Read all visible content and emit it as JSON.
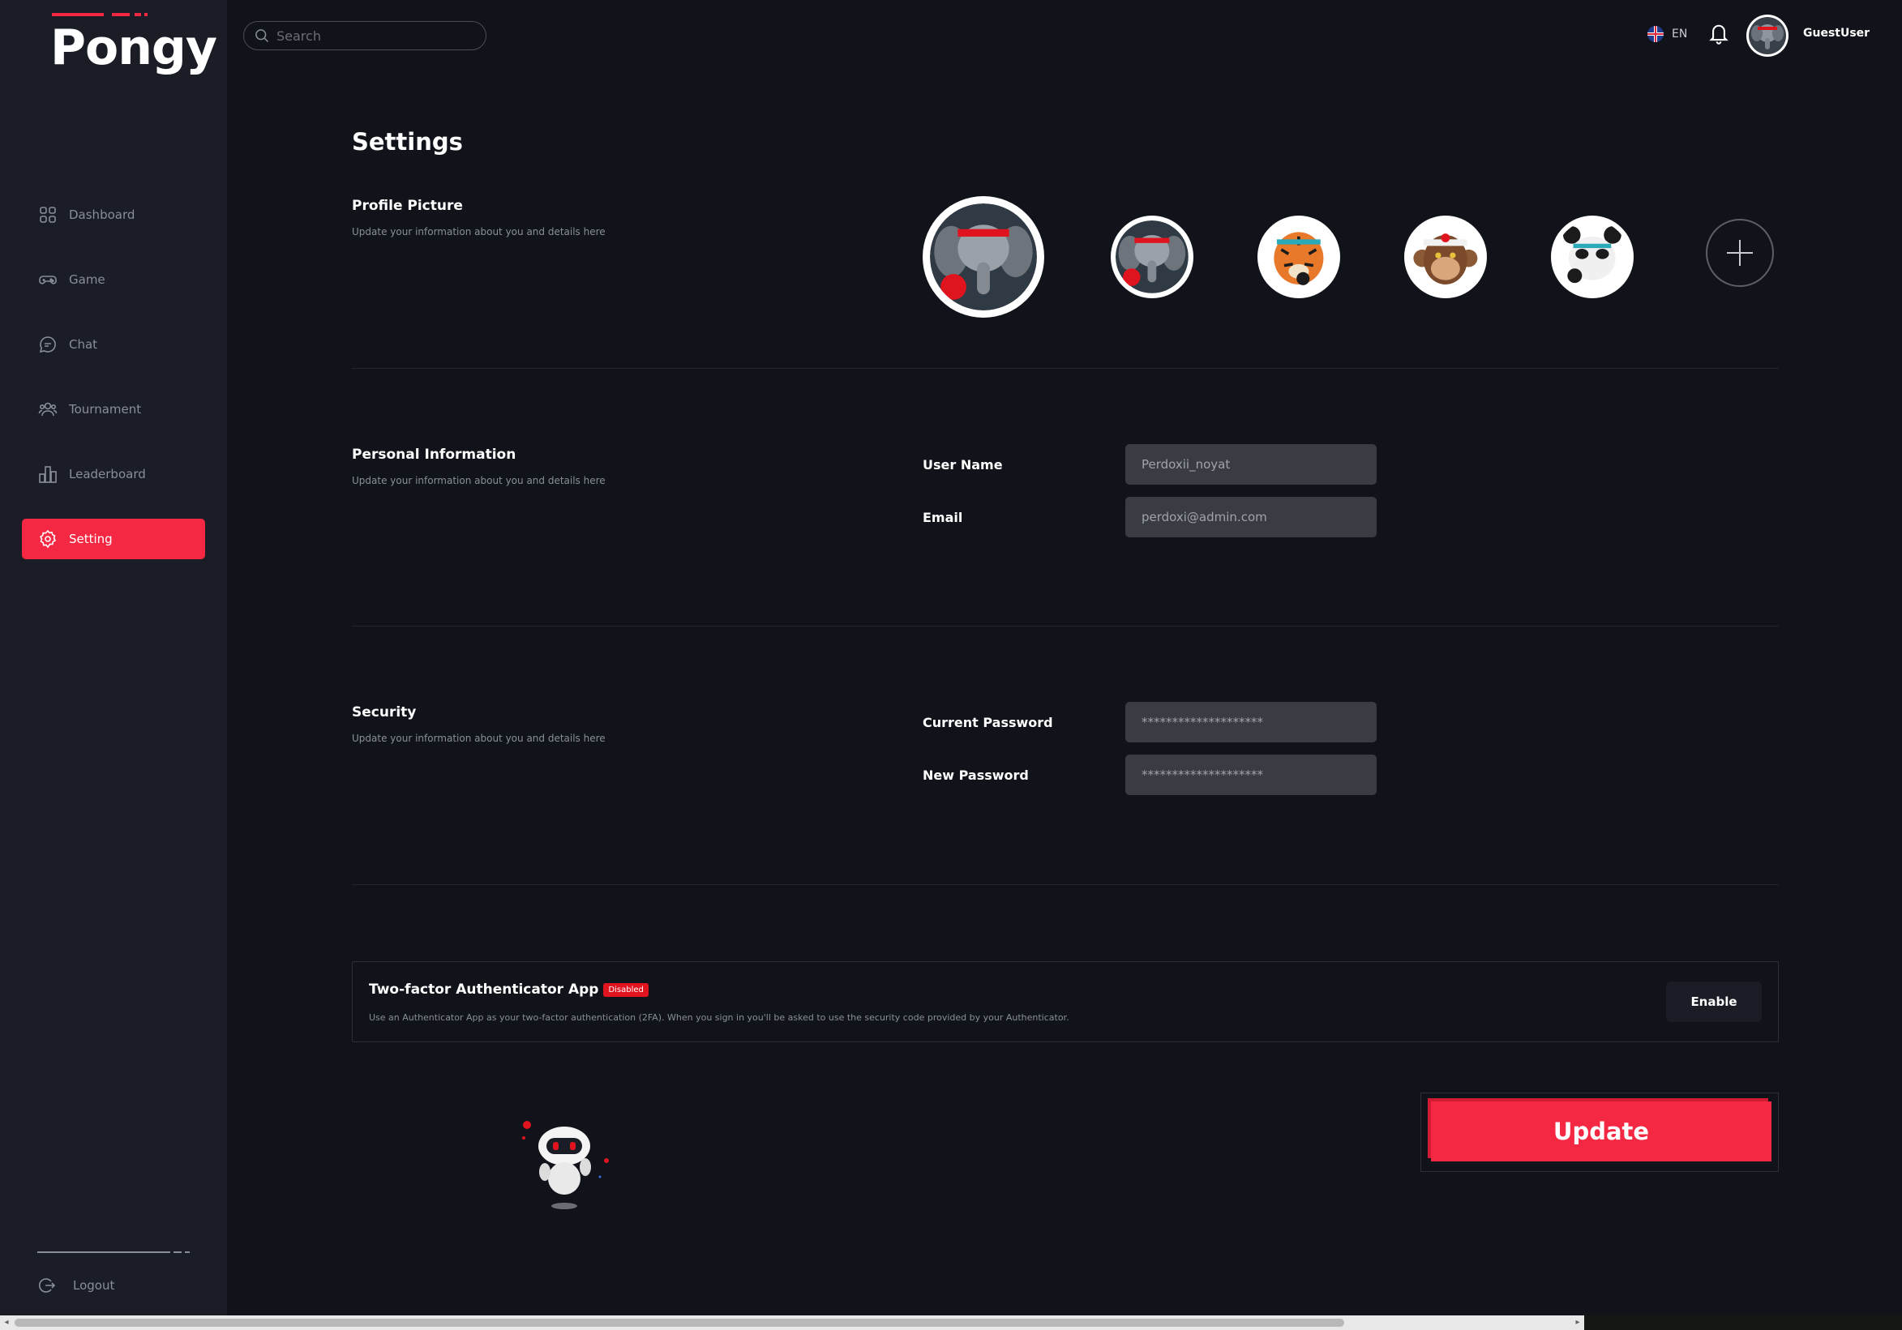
{
  "app": {
    "logo": "Pongy"
  },
  "sidebar": {
    "items": [
      {
        "label": "Dashboard",
        "icon": "grid-icon"
      },
      {
        "label": "Game",
        "icon": "gamepad-icon"
      },
      {
        "label": "Chat",
        "icon": "chat-icon"
      },
      {
        "label": "Tournament",
        "icon": "users-icon"
      },
      {
        "label": "Leaderboard",
        "icon": "bar-chart-icon"
      },
      {
        "label": "Setting",
        "icon": "gear-icon",
        "active": true
      }
    ],
    "logout": "Logout"
  },
  "topbar": {
    "search_placeholder": "Search",
    "language": "EN",
    "username": "GuestUser"
  },
  "page": {
    "title": "Settings",
    "profile": {
      "title": "Profile Picture",
      "desc": "Update your information about you and details here",
      "avatars": [
        "elephant-avatar",
        "elephant-avatar",
        "tiger-avatar",
        "monkey-avatar",
        "panda-avatar"
      ]
    },
    "personal": {
      "title": "Personal Information",
      "desc": "Update your information about you and details here",
      "username_label": "User Name",
      "username_placeholder": "Perdoxii_noyat",
      "email_label": "Email",
      "email_placeholder": "perdoxi@admin.com"
    },
    "security": {
      "title": "Security",
      "desc": "Update your information about you and details here",
      "current_label": "Current Password",
      "current_placeholder": "********************",
      "new_label": "New Password",
      "new_placeholder": "********************"
    },
    "twofa": {
      "title": "Two-factor Authenticator App",
      "badge": "Disabled",
      "desc": "Use an Authenticator App as your two-factor authentication (2FA). When you sign in you'll be asked to use the security code provided by your Authenticator.",
      "enable_label": "Enable"
    },
    "update_label": "Update"
  },
  "colors": {
    "accent": "#f52843",
    "background": "#11131a",
    "sidebar": "#1b1d26",
    "input": "#3a3c43"
  }
}
